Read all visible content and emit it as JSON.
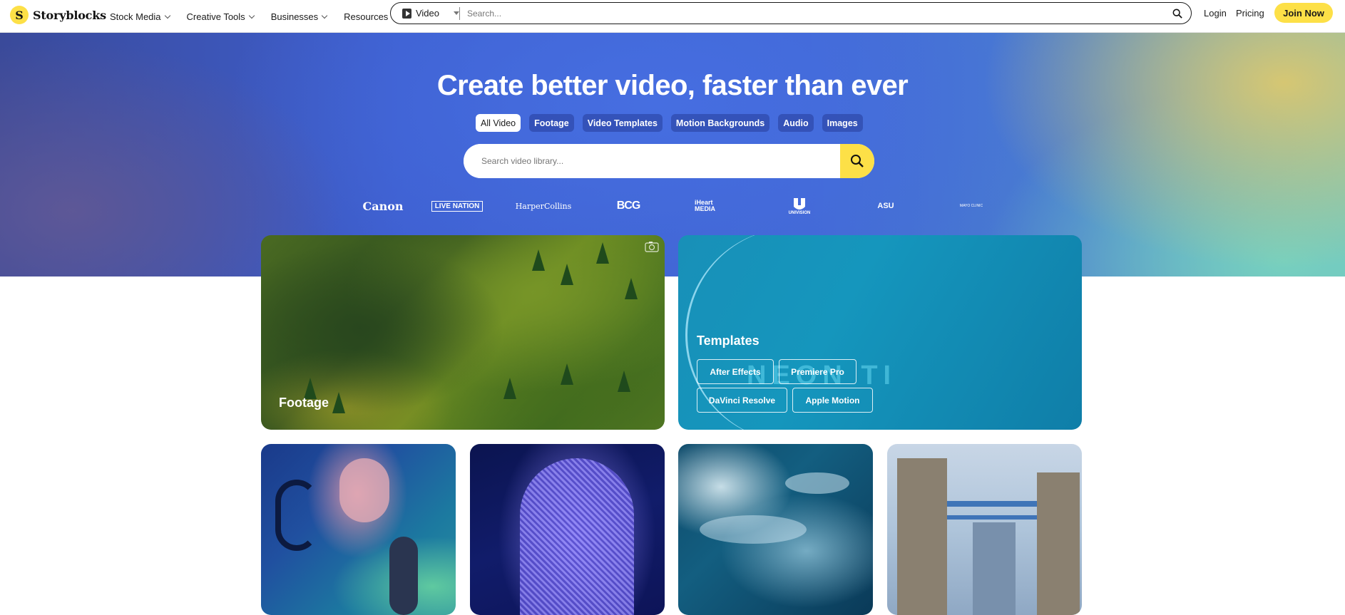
{
  "nav": {
    "brand": "Storyblocks",
    "brand_mark": "S",
    "menu": [
      "Stock Media",
      "Creative Tools",
      "Businesses",
      "Resources"
    ],
    "search_type": "Video",
    "search_placeholder": "Search...",
    "login": "Login",
    "pricing": "Pricing",
    "join": "Join Now"
  },
  "hero": {
    "title": "Create better video, faster than ever",
    "chips": [
      "All Video",
      "Footage",
      "Video Templates",
      "Motion Backgrounds",
      "Audio",
      "Images"
    ],
    "active_chip": "All Video",
    "search_placeholder": "Search video library...",
    "brands": [
      "Canon",
      "LIVE NATION",
      "HarperCollins",
      "BCG",
      "iHeart MEDIA",
      "UNIVISION",
      "ASU",
      "MAYO CLINIC"
    ]
  },
  "cards": {
    "footage_label": "Footage",
    "templates_label": "Templates",
    "templates_ghost": "NEON TI",
    "template_buttons": [
      "After Effects",
      "Premiere Pro",
      "DaVinci Resolve",
      "Apple Motion"
    ]
  },
  "colors": {
    "accent_yellow": "#fde047",
    "hero_blue": "#3e5fd0",
    "templates_teal": "#1890b8"
  }
}
